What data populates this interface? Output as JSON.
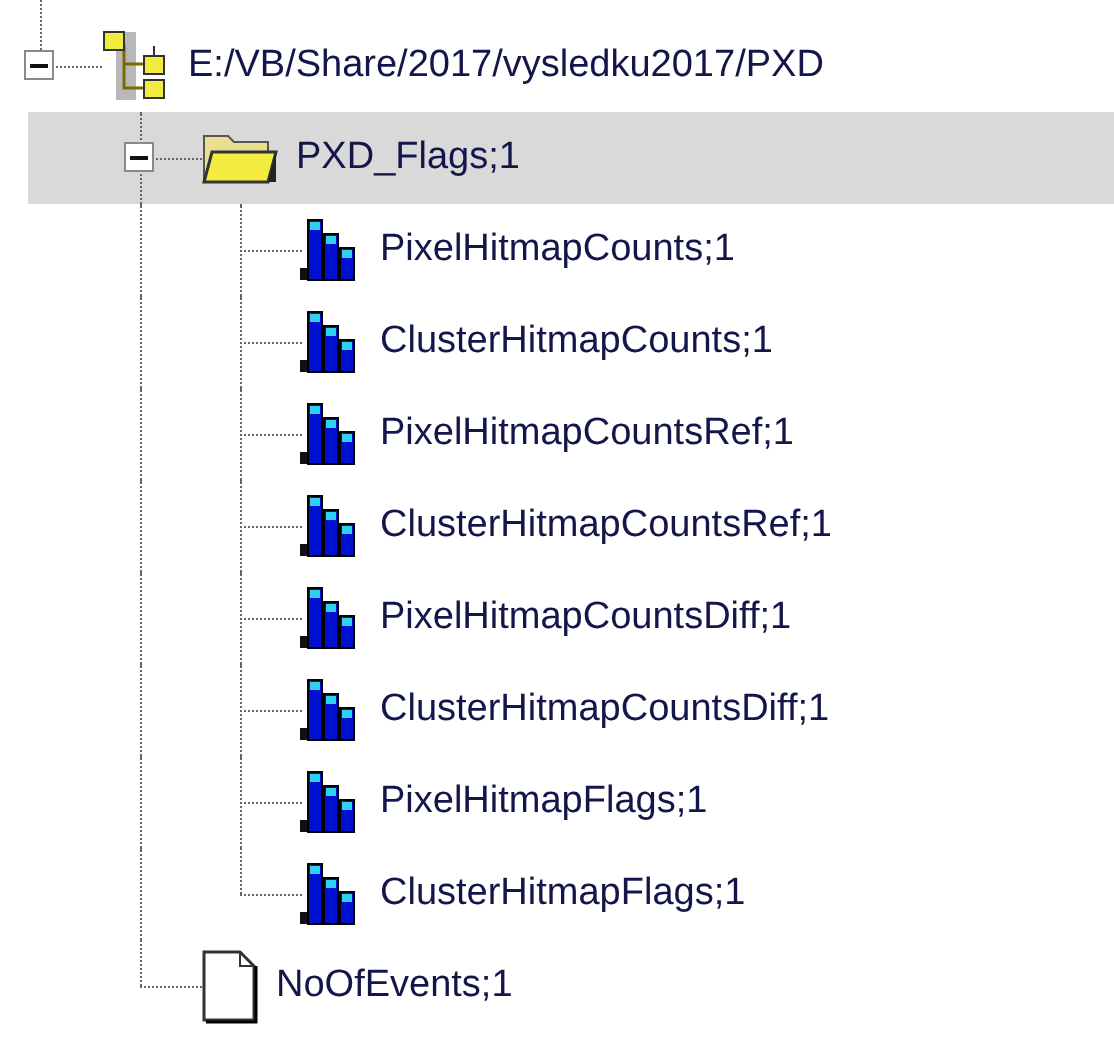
{
  "tree": [
    {
      "kind": "file",
      "label": "E:/VB/Share/2017/vysledku2017/PXD",
      "expanded": true,
      "selected": false,
      "children": [
        {
          "kind": "folder",
          "label": "PXD_Flags;1",
          "expanded": true,
          "selected": true,
          "children": [
            {
              "kind": "histogram",
              "label": "PixelHitmapCounts;1",
              "selected": false
            },
            {
              "kind": "histogram",
              "label": "ClusterHitmapCounts;1",
              "selected": false
            },
            {
              "kind": "histogram",
              "label": "PixelHitmapCountsRef;1",
              "selected": false
            },
            {
              "kind": "histogram",
              "label": "ClusterHitmapCountsRef;1",
              "selected": false
            },
            {
              "kind": "histogram",
              "label": "PixelHitmapCountsDiff;1",
              "selected": false
            },
            {
              "kind": "histogram",
              "label": "ClusterHitmapCountsDiff;1",
              "selected": false
            },
            {
              "kind": "histogram",
              "label": "PixelHitmapFlags;1",
              "selected": false
            },
            {
              "kind": "histogram",
              "label": "ClusterHitmapFlags;1",
              "selected": false
            }
          ]
        },
        {
          "kind": "leaf",
          "label": "NoOfEvents;1",
          "selected": false
        }
      ]
    }
  ]
}
